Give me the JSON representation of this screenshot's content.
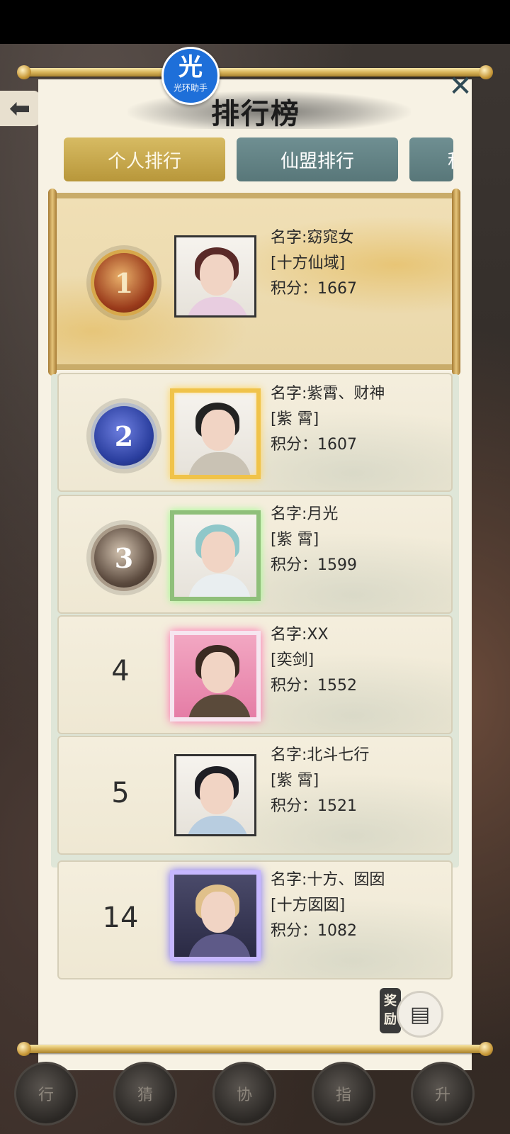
{
  "overlay": {
    "badge_glyph": "光",
    "badge_text": "光环助手"
  },
  "header": {
    "title": "排行榜",
    "close_glyph": "✕",
    "back_glyph": "⬅"
  },
  "tabs": [
    {
      "label": "个人排行",
      "active": true
    },
    {
      "label": "仙盟排行",
      "active": false
    },
    {
      "label": "积",
      "active": false
    }
  ],
  "rankings": [
    {
      "rank": "1",
      "name": "名字:窈窕女",
      "guild": "[十方仙域]",
      "score": "积分：1667"
    },
    {
      "rank": "2",
      "name": "名字:紫霄、财神",
      "guild": "[紫  霄]",
      "score": "积分：1607"
    },
    {
      "rank": "3",
      "name": "名字:月光",
      "guild": "[紫  霄]",
      "score": "积分：1599"
    },
    {
      "rank": "4",
      "name": "名字:XX",
      "guild": "[奕剑]",
      "score": "积分：1552"
    },
    {
      "rank": "5",
      "name": "名字:北斗七行",
      "guild": "[紫  霄]",
      "score": "积分：1521"
    }
  ],
  "my_rank": {
    "rank": "14",
    "name": "名字:十方、囡囡",
    "guild": "[十方囡囡]",
    "score": "积分：1082"
  },
  "reward": {
    "label": "奖励"
  },
  "bottom_bar": {
    "labels": [
      "行",
      "猜",
      "协",
      "指",
      "升"
    ]
  },
  "colors": {
    "gold_tab": "#c9a94a",
    "teal_tab": "#5f8082",
    "panel": "#f7f2e4"
  }
}
